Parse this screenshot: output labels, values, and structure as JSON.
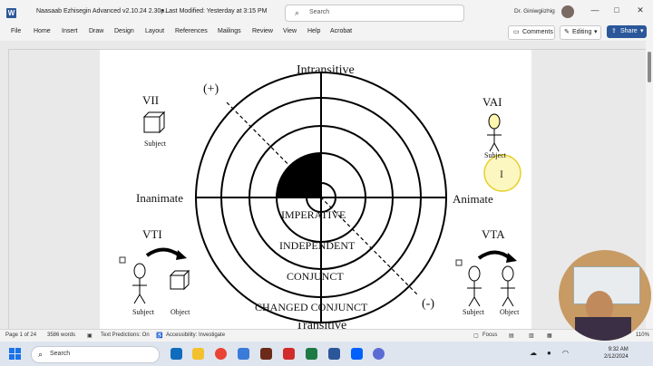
{
  "title_bar": {
    "app_icon": "word-logo-icon",
    "doc_title": "Naasaab Ezhisegin Advanced v2.10.24 2.30p...",
    "last_modified": "• Last Modified: Yesterday at 3:15 PM",
    "search_placeholder": "Search",
    "user_name": "Dr. Giniwgiizhig",
    "min_glyph": "—",
    "max_glyph": "□",
    "close_glyph": "✕"
  },
  "ribbon": {
    "tabs": [
      "File",
      "Home",
      "Insert",
      "Draw",
      "Design",
      "Layout",
      "References",
      "Mailings",
      "Review",
      "View",
      "Help",
      "Acrobat"
    ],
    "comments": "Comments",
    "editing": "Editing",
    "share": "Share"
  },
  "diagram": {
    "top": "Intransitive",
    "bottom": "Transitive",
    "left": "Inanimate",
    "right": "Animate",
    "plus": "(+)",
    "minus": "(-)",
    "rings": [
      "IMPERATIVE",
      "INDEPENDENT",
      "CONJUNCT",
      "CHANGED CONJUNCT"
    ],
    "vii": "VII",
    "vii_sub": "Subject",
    "vai": "VAI",
    "vai_sub": "Subject",
    "vti": "VTI",
    "vti_subject": "Subject",
    "vti_object": "Object",
    "vta": "VTA",
    "vta_subject": "Subject",
    "vta_object": "Object"
  },
  "status_bar": {
    "page": "Page 1 of 24",
    "words": "3586 words",
    "predictions": "Text Predictions: On",
    "accessibility": "Accessibility: Investigate",
    "focus": "Focus",
    "zoom": "110%"
  },
  "taskbar": {
    "search_placeholder": "Search",
    "time": "9:32 AM",
    "date": "2/12/2024"
  },
  "colors": {
    "word_blue": "#2b579a",
    "wedge": "#000000",
    "cursor_highlight": "#f5e94a"
  }
}
